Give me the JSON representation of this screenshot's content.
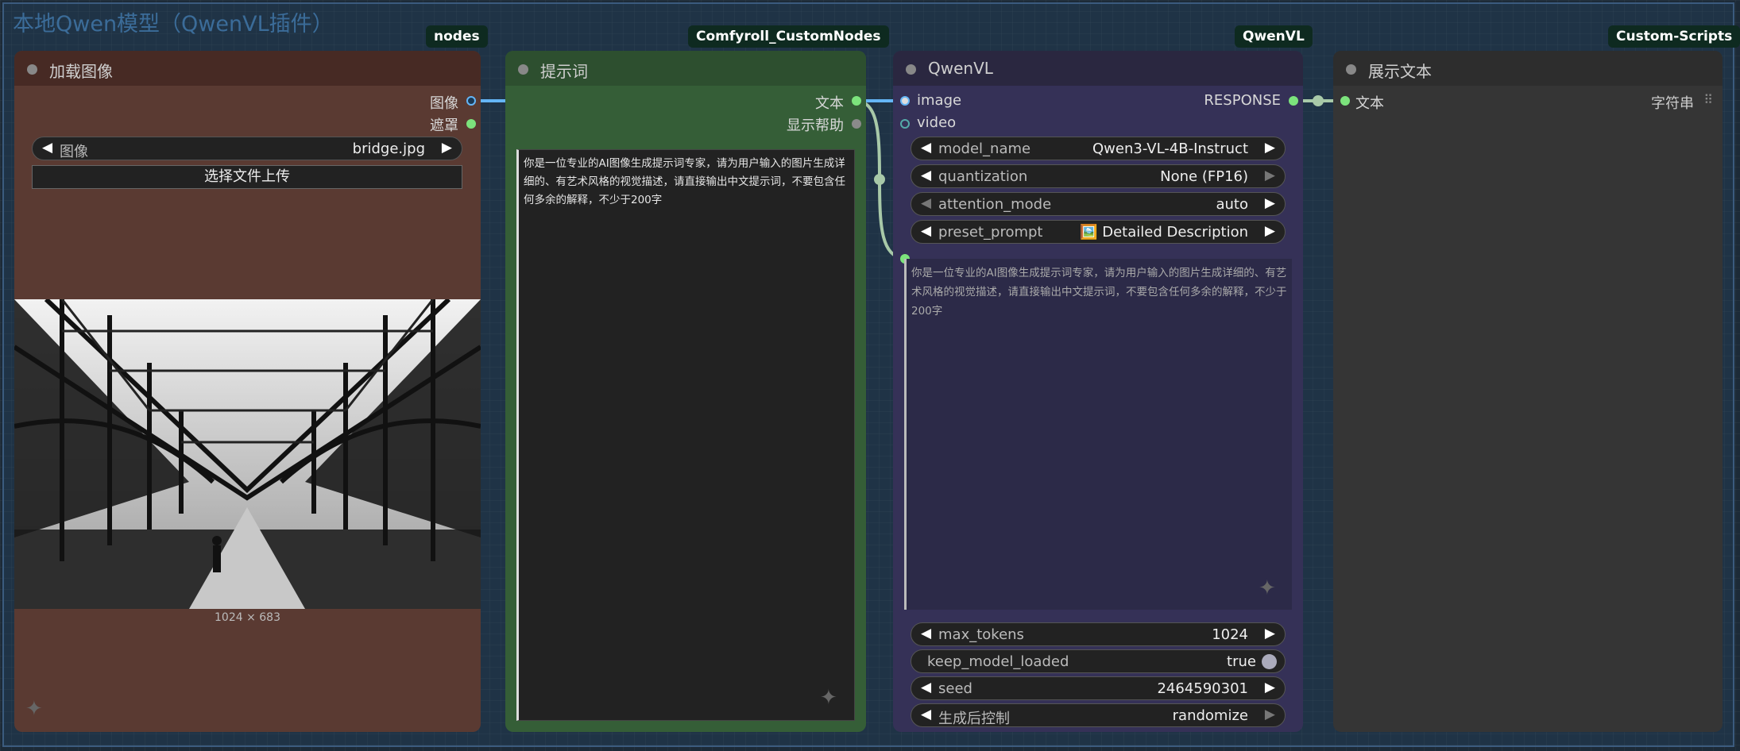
{
  "group": {
    "title": "本地Qwen模型（QwenVL插件）"
  },
  "tags": [
    "nodes",
    "Comfyroll_CustomNodes",
    "QwenVL",
    "Custom-Scripts"
  ],
  "load_image_node": {
    "title": "加载图像",
    "outputs": [
      "图像",
      "遮罩"
    ],
    "image_widget": {
      "label": "图像",
      "value": "bridge.jpg"
    },
    "upload_button": "选择文件上传",
    "image_size": "1024 × 683"
  },
  "prompt_node": {
    "title": "提示词",
    "outputs": [
      "文本",
      "显示帮助"
    ],
    "text": "你是一位专业的AI图像生成提示词专家，请为用户输入的图片生成详细的、有艺术风格的视觉描述，请直接输出中文提示词，不要包含任何多余的解释，不少于200字"
  },
  "qwenvl_node": {
    "title": "QwenVL",
    "inputs": [
      "image",
      "video"
    ],
    "output": "RESPONSE",
    "widgets": {
      "model_name": {
        "label": "model_name",
        "value": "Qwen3-VL-4B-Instruct"
      },
      "quantization": {
        "label": "quantization",
        "value": "None (FP16)"
      },
      "attention_mode": {
        "label": "attention_mode",
        "value": "auto"
      },
      "preset_prompt": {
        "label": "preset_prompt",
        "value": "🖼️ Detailed Description"
      },
      "max_tokens": {
        "label": "max_tokens",
        "value": "1024"
      },
      "keep_model_loaded": {
        "label": "keep_model_loaded",
        "value": "true"
      },
      "seed": {
        "label": "seed",
        "value": "2464590301"
      },
      "control_after_generate": {
        "label": "生成后控制",
        "value": "randomize"
      }
    },
    "custom_prompt": "你是一位专业的AI图像生成提示词专家，请为用户输入的图片生成详细的、有艺术风格的视觉描述，请直接输出中文提示词，不要包含任何多余的解释，不少于200字"
  },
  "show_text_node": {
    "title": "展示文本",
    "input": "文本",
    "input_type": "字符串"
  },
  "colors": {
    "image_port": "#64b5f6",
    "text_port": "#7ce37c",
    "load_image_bg": "#5a3a32",
    "prompt_bg": "#355e37",
    "qwen_bg": "#353157",
    "show_text_bg": "#353535"
  }
}
